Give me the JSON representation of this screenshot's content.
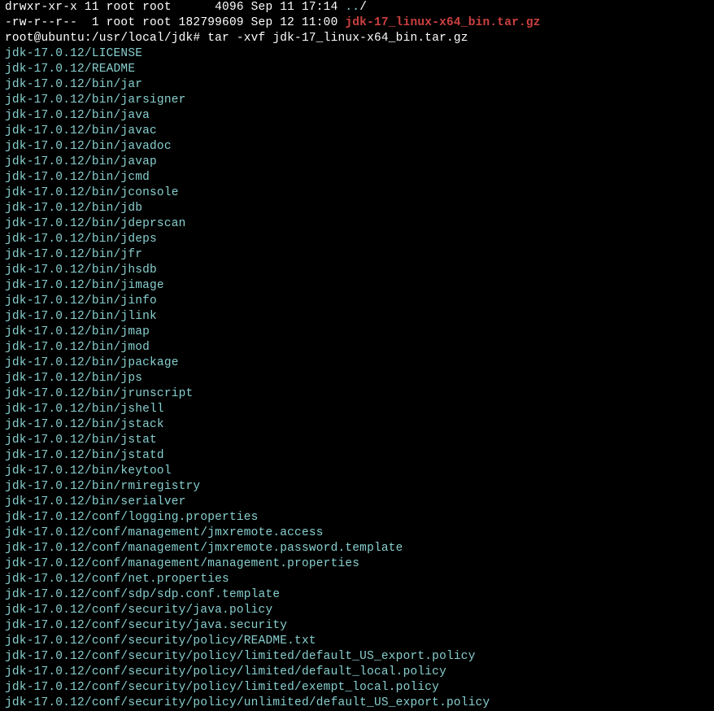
{
  "ls_line1_a": "drwxr-xr-x 11 root root      4096 Sep 11 17:14 ",
  "ls_line1_b": "..",
  "ls_line1_c": "/",
  "ls_line2_a": "-rw-r--r--  1 root root 182799609 Sep 12 11:00 ",
  "ls_line2_b": "jdk-17_linux-x64_bin.tar.gz",
  "prompt": "root@ubuntu:/usr/local/jdk#",
  "command": " tar -xvf jdk-17_linux-x64_bin.tar.gz",
  "extracted": [
    "jdk-17.0.12/LICENSE",
    "jdk-17.0.12/README",
    "jdk-17.0.12/bin/jar",
    "jdk-17.0.12/bin/jarsigner",
    "jdk-17.0.12/bin/java",
    "jdk-17.0.12/bin/javac",
    "jdk-17.0.12/bin/javadoc",
    "jdk-17.0.12/bin/javap",
    "jdk-17.0.12/bin/jcmd",
    "jdk-17.0.12/bin/jconsole",
    "jdk-17.0.12/bin/jdb",
    "jdk-17.0.12/bin/jdeprscan",
    "jdk-17.0.12/bin/jdeps",
    "jdk-17.0.12/bin/jfr",
    "jdk-17.0.12/bin/jhsdb",
    "jdk-17.0.12/bin/jimage",
    "jdk-17.0.12/bin/jinfo",
    "jdk-17.0.12/bin/jlink",
    "jdk-17.0.12/bin/jmap",
    "jdk-17.0.12/bin/jmod",
    "jdk-17.0.12/bin/jpackage",
    "jdk-17.0.12/bin/jps",
    "jdk-17.0.12/bin/jrunscript",
    "jdk-17.0.12/bin/jshell",
    "jdk-17.0.12/bin/jstack",
    "jdk-17.0.12/bin/jstat",
    "jdk-17.0.12/bin/jstatd",
    "jdk-17.0.12/bin/keytool",
    "jdk-17.0.12/bin/rmiregistry",
    "jdk-17.0.12/bin/serialver",
    "jdk-17.0.12/conf/logging.properties",
    "jdk-17.0.12/conf/management/jmxremote.access",
    "jdk-17.0.12/conf/management/jmxremote.password.template",
    "jdk-17.0.12/conf/management/management.properties",
    "jdk-17.0.12/conf/net.properties",
    "jdk-17.0.12/conf/sdp/sdp.conf.template",
    "jdk-17.0.12/conf/security/java.policy",
    "jdk-17.0.12/conf/security/java.security",
    "jdk-17.0.12/conf/security/policy/README.txt",
    "jdk-17.0.12/conf/security/policy/limited/default_US_export.policy",
    "jdk-17.0.12/conf/security/policy/limited/default_local.policy",
    "jdk-17.0.12/conf/security/policy/limited/exempt_local.policy",
    "jdk-17.0.12/conf/security/policy/unlimited/default_US_export.policy"
  ]
}
